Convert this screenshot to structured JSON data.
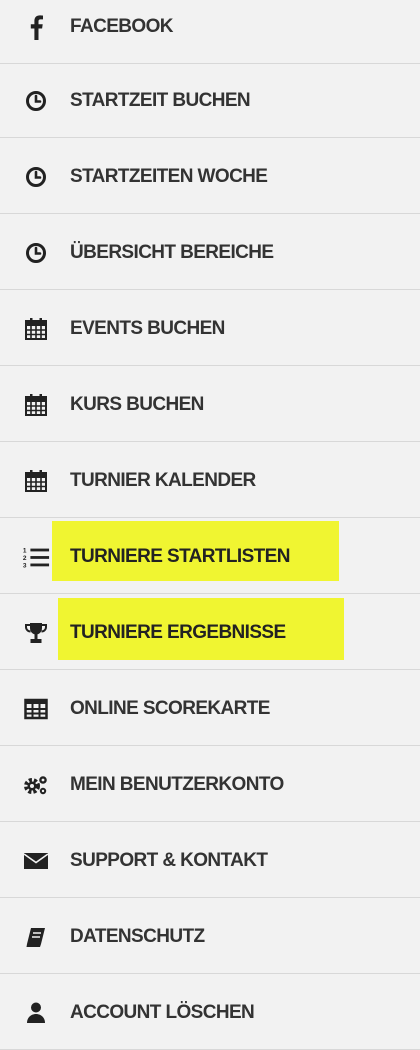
{
  "menu": {
    "items": [
      {
        "label": "FACEBOOK",
        "icon": "facebook-icon"
      },
      {
        "label": "STARTZEIT BUCHEN",
        "icon": "clock-icon"
      },
      {
        "label": "STARTZEITEN WOCHE",
        "icon": "clock-icon"
      },
      {
        "label": "ÜBERSICHT BEREICHE",
        "icon": "clock-icon"
      },
      {
        "label": "EVENTS BUCHEN",
        "icon": "calendar-icon"
      },
      {
        "label": "KURS BUCHEN",
        "icon": "calendar-icon"
      },
      {
        "label": "TURNIER KALENDER",
        "icon": "calendar-icon"
      },
      {
        "label": "TURNIERE STARTLISTEN",
        "icon": "ordered-list-icon",
        "highlighted": true
      },
      {
        "label": "TURNIERE ERGEBNISSE",
        "icon": "trophy-icon",
        "highlighted": true
      },
      {
        "label": "ONLINE SCOREKARTE",
        "icon": "table-icon"
      },
      {
        "label": "MEIN BENUTZERKONTO",
        "icon": "gears-icon"
      },
      {
        "label": "SUPPORT & KONTAKT",
        "icon": "envelope-icon"
      },
      {
        "label": "DATENSCHUTZ",
        "icon": "book-icon"
      },
      {
        "label": "ACCOUNT LÖSCHEN",
        "icon": "user-icon"
      }
    ]
  },
  "colors": {
    "background": "#f2f2f2",
    "text": "#333333",
    "highlight": "#f0f531",
    "divider": "#d8d8d8"
  }
}
